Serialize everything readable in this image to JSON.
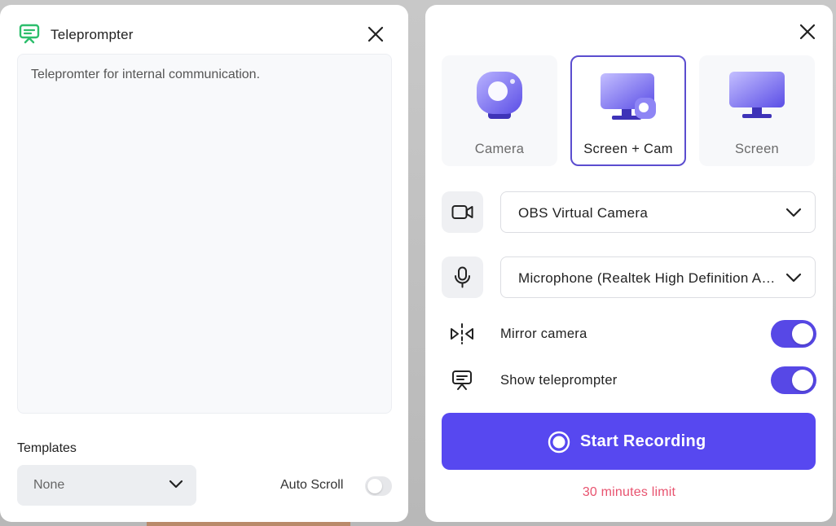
{
  "teleprompter": {
    "title": "Teleprompter",
    "text": "Telepromter for internal communication.",
    "templates_label": "Templates",
    "templates_value": "None",
    "auto_scroll_label": "Auto Scroll",
    "auto_scroll_on": false
  },
  "recorder": {
    "modes": [
      {
        "label": "Camera",
        "icon": "camera-mode-icon",
        "selected": false
      },
      {
        "label": "Screen + Cam",
        "icon": "screen-cam-mode-icon",
        "selected": true
      },
      {
        "label": "Screen",
        "icon": "screen-mode-icon",
        "selected": false
      }
    ],
    "camera_device": "OBS Virtual Camera",
    "microphone_device": "Microphone (Realtek High Definition Audio)",
    "options": [
      {
        "label": "Mirror camera",
        "icon": "mirror-icon",
        "enabled": true
      },
      {
        "label": "Show teleprompter",
        "icon": "teleprompter-icon",
        "enabled": true
      }
    ],
    "record_label": "Start Recording",
    "limit_text": "30 minutes limit"
  },
  "colors": {
    "accent": "#5748F0",
    "limit_text": "#E8536F",
    "teleprompter_logo": "#2DBE6C"
  }
}
